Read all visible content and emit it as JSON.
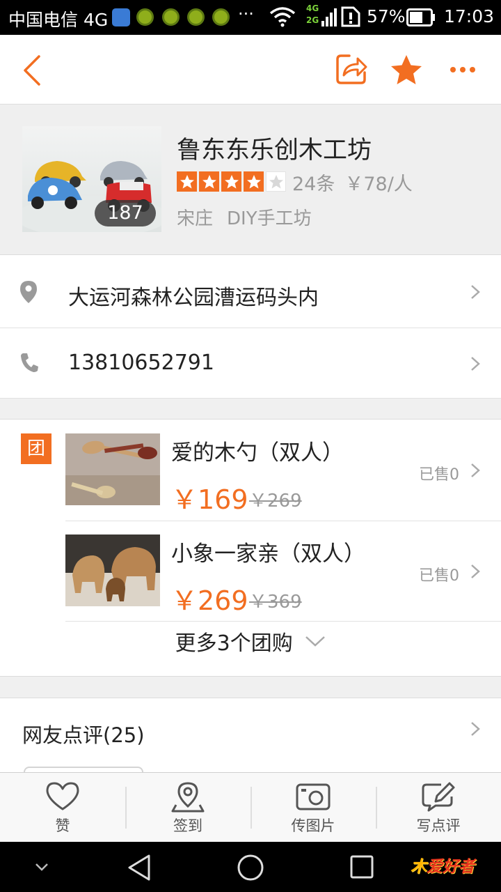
{
  "status_bar": {
    "carrier": "中国电信 4G",
    "more": "···",
    "network_labels": [
      "4G",
      "2G"
    ],
    "battery": "57%",
    "time": "17:03"
  },
  "nav": {
    "icons": [
      "back-arrow-icon",
      "share-icon",
      "favorite-star-icon",
      "more-menu-icon"
    ],
    "accent_color": "#f26e21"
  },
  "shop": {
    "name": "鲁东东乐创木工坊",
    "photo_count": "187",
    "rating": 4,
    "rating_max": 5,
    "review_count": "24条",
    "avg_price": "￥78/人",
    "area": "宋庄",
    "category": "DIY手工坊"
  },
  "info": {
    "address": "大运河森林公园漕运码头内",
    "phone": "13810652791"
  },
  "deals": {
    "badge": "团",
    "items": [
      {
        "title": "爱的木勺（双人）",
        "price": "￥169",
        "original": "￥269",
        "sold": "已售0"
      },
      {
        "title": "小象一家亲（双人）",
        "price": "￥269",
        "original": "￥369",
        "sold": "已售0"
      }
    ],
    "more_label": "更多3个团购"
  },
  "reviews": {
    "title": "网友点评(25)"
  },
  "tabbar": {
    "items": [
      {
        "label": "赞",
        "icon": "heart-icon"
      },
      {
        "label": "签到",
        "icon": "checkin-pin-icon"
      },
      {
        "label": "传图片",
        "icon": "camera-upload-icon"
      },
      {
        "label": "写点评",
        "icon": "write-review-icon"
      }
    ]
  },
  "system_nav": {
    "icons": [
      "collapse-down-icon",
      "back-triangle-icon",
      "home-circle-icon",
      "recents-square-icon"
    ],
    "watermark": "爱好者"
  }
}
